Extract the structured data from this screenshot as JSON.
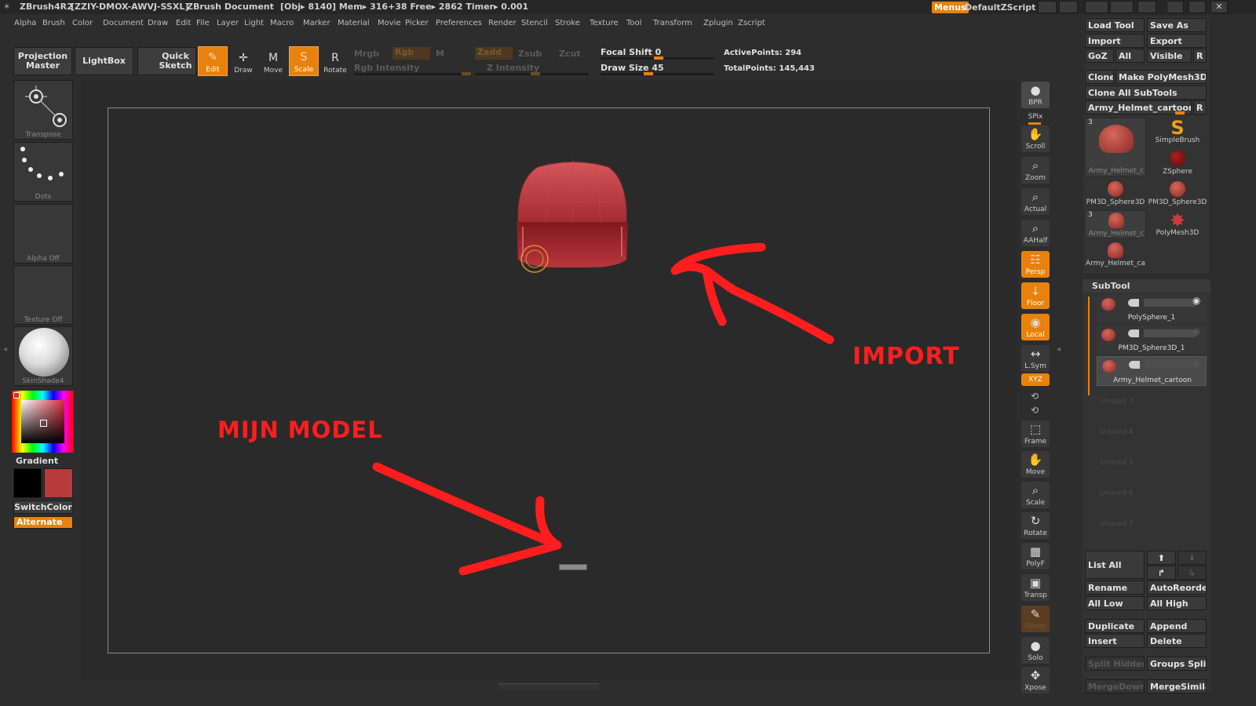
{
  "title_bar": {
    "app": "ZBrush4R2",
    "session": "[ZZIY-DMOX-AWVJ-SSXL]",
    "document": "ZBrush Document",
    "stats": "[Obj▸ 8140] Mem▸ 316+38 Free▸ 2862 Timer▸ 0.001",
    "menus_button": "Menus",
    "script_name": "DefaultZScript"
  },
  "menu_items": [
    "Alpha",
    "Brush",
    "Color",
    "Document",
    "Draw",
    "Edit",
    "File",
    "Layer",
    "Light",
    "Macro",
    "Marker",
    "Material",
    "Movie",
    "Picker",
    "Preferences",
    "Render",
    "Stencil",
    "Stroke",
    "Texture",
    "Tool",
    "Transform",
    "Zplugin",
    "Zscript"
  ],
  "shelf": {
    "projection_master": "Projection Master",
    "lightbox": "LightBox",
    "quick_sketch": "Quick Sketch",
    "tools": [
      {
        "label": "Edit",
        "glyph": "✎",
        "active": true
      },
      {
        "label": "Draw",
        "glyph": "✛",
        "active": false
      },
      {
        "label": "Move",
        "glyph": "M",
        "active": false
      },
      {
        "label": "Scale",
        "glyph": "S",
        "active": true
      },
      {
        "label": "Rotate",
        "glyph": "R",
        "active": false
      }
    ],
    "mrgb": "Mrgb",
    "rgb": "Rgb",
    "m": "M",
    "rgb_intensity": "Rgb Intensity",
    "zadd": "Zadd",
    "zsub": "Zsub",
    "zcut": "Zcut",
    "z_intensity": "Z Intensity",
    "focal_shift": "Focal Shift 0",
    "focal_shift_value": 0,
    "draw_size": "Draw Size 45",
    "draw_size_value": 45,
    "active_points": "ActivePoints: 294",
    "total_points": "TotalPoints: 145,443"
  },
  "left_tray": {
    "transpose": "Transpose",
    "dots": "Dots",
    "alpha_off": "Alpha Off",
    "texture_off": "Texture Off",
    "material": "SkinShade4",
    "gradient": "Gradient",
    "switch_color": "SwitchColor",
    "alternate": "Alternate",
    "main_color": "#b83a3a",
    "secondary_color": "#000000"
  },
  "right_shelf": [
    {
      "label": "BPR",
      "glyph": "●",
      "active": false
    },
    {
      "label": "SPix",
      "glyph": "",
      "active": false
    },
    {
      "label": "Scroll",
      "glyph": "✋",
      "active": false
    },
    {
      "label": "Zoom",
      "glyph": "⌕",
      "active": false
    },
    {
      "label": "Actual",
      "glyph": "⌕",
      "active": false
    },
    {
      "label": "AAHalf",
      "glyph": "⌕",
      "active": false
    },
    {
      "label": "Persp",
      "glyph": "☷",
      "active": true
    },
    {
      "label": "Floor",
      "glyph": "↓",
      "active": true
    },
    {
      "label": "Local",
      "glyph": "◉",
      "active": true
    },
    {
      "label": "L.Sym",
      "glyph": "↔",
      "active": false
    },
    {
      "label": "XYZ",
      "glyph": "",
      "active": true
    },
    {
      "label": "Frame",
      "glyph": "⬚",
      "active": false
    },
    {
      "label": "Move",
      "glyph": "✋",
      "active": false
    },
    {
      "label": "Scale",
      "glyph": "⌕",
      "active": false
    },
    {
      "label": "Rotate",
      "glyph": "↻",
      "active": false
    },
    {
      "label": "PolyF",
      "glyph": "▦",
      "active": false
    },
    {
      "label": "Transp",
      "glyph": "▣",
      "active": false
    },
    {
      "label": "Ghost",
      "glyph": "✎",
      "active": false
    },
    {
      "label": "Solo",
      "glyph": "●",
      "active": false
    },
    {
      "label": "Xpose",
      "glyph": "✥",
      "active": false
    }
  ],
  "tool_palette": {
    "load_tool": "Load Tool",
    "save_as": "Save As",
    "import": "Import",
    "export": "Export",
    "goz": "GoZ",
    "all": "All",
    "visible": "Visible",
    "r": "R",
    "clone": "Clone",
    "make_polymesh": "Make PolyMesh3D",
    "clone_all_subtools": "Clone All SubTools",
    "current_tool": "Army_Helmet_cartoon",
    "tools": [
      {
        "label": "Army_Helmet_c",
        "count": "3"
      },
      {
        "label": "SimpleBrush",
        "count": ""
      },
      {
        "label": "ZSphere",
        "count": ""
      },
      {
        "label": "PM3D_Sphere3D",
        "count": ""
      },
      {
        "label": "PM3D_Sphere3D",
        "count": ""
      },
      {
        "label": "Army_Helmet_c",
        "count": "3"
      },
      {
        "label": "PolyMesh3D",
        "count": ""
      },
      {
        "label": "Army_Helmet_ca",
        "count": ""
      }
    ]
  },
  "subtool": {
    "title": "SubTool",
    "items": [
      "PolySphere_1",
      "PM3D_Sphere3D_1",
      "Army_Helmet_cartoon"
    ],
    "unused": [
      "Unused 3",
      "Unused 4",
      "Unused 5",
      "Unused 6",
      "Unused 7"
    ],
    "list_all": "List All",
    "rename": "Rename",
    "auto_reorder": "AutoReorder",
    "all_low": "All Low",
    "all_high": "All High",
    "duplicate": "Duplicate",
    "append": "Append",
    "insert": "Insert",
    "delete": "Delete",
    "split_hidden": "Split Hidden",
    "groups_split": "Groups Split",
    "merge_down": "MergeDown",
    "merge_similar": "MergeSimilar"
  },
  "annotations": {
    "import": "IMPORT",
    "mijn_model": "MIJN MODEL"
  }
}
